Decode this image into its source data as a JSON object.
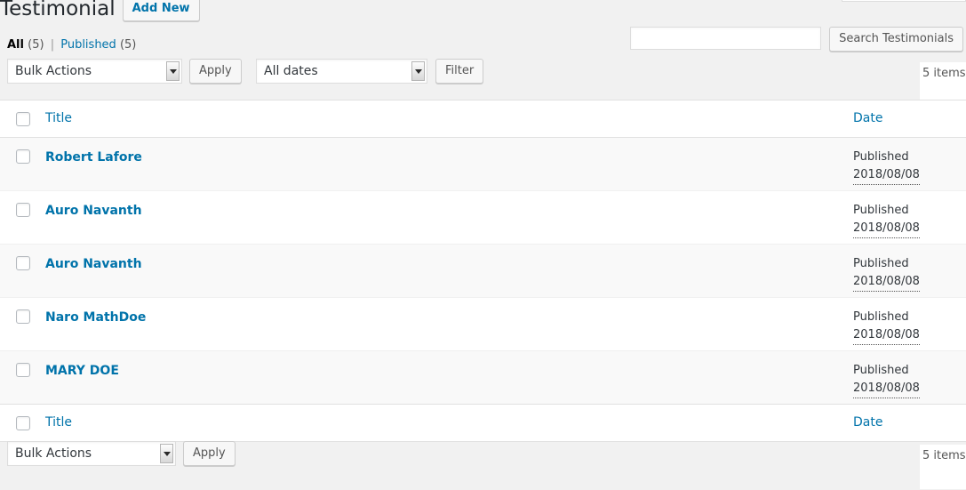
{
  "header": {
    "title": "Testimonial",
    "add_new_label": "Add New"
  },
  "status_links": {
    "all_label": "All",
    "all_count": "(5)",
    "separator": "|",
    "published_label": "Published",
    "published_count": "(5)"
  },
  "search": {
    "value": "",
    "placeholder": "",
    "submit_label": "Search Testimonials"
  },
  "tablenav_top": {
    "bulk_actions_label": "Bulk Actions",
    "apply_label": "Apply",
    "dates_label": "All dates",
    "filter_label": "Filter",
    "items_count": "5 items"
  },
  "tablenav_bottom": {
    "bulk_actions_label": "Bulk Actions",
    "apply_label": "Apply",
    "items_count": "5 items"
  },
  "table": {
    "columns": {
      "title": "Title",
      "date": "Date"
    },
    "rows": [
      {
        "title": "Robert Lafore",
        "status": "Published",
        "date": "2018/08/08"
      },
      {
        "title": "Auro Navanth",
        "status": "Published",
        "date": "2018/08/08"
      },
      {
        "title": "Auro Navanth",
        "status": "Published",
        "date": "2018/08/08"
      },
      {
        "title": "Naro MathDoe",
        "status": "Published",
        "date": "2018/08/08"
      },
      {
        "title": "MARY DOE",
        "status": "Published",
        "date": "2018/08/08"
      }
    ]
  },
  "colors": {
    "link": "#0073aa",
    "page_bg": "#f1f1f1",
    "row_alt_bg": "#f9f9f9",
    "text": "#32373c"
  }
}
